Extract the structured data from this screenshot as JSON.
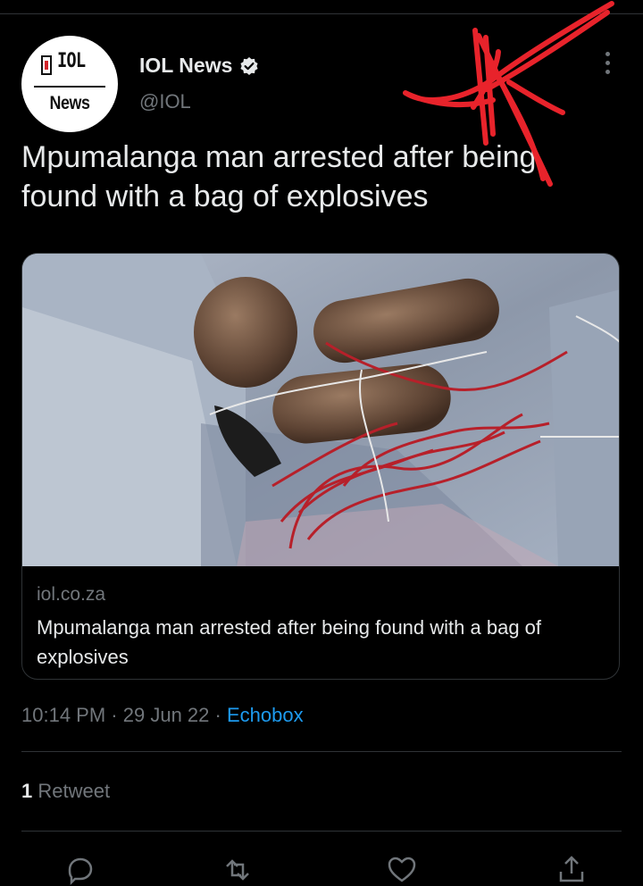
{
  "author": {
    "display_name": "IOL News",
    "handle": "@IOL",
    "verified": true,
    "avatar_logo_top": "IOL",
    "avatar_logo_bottom": "News"
  },
  "tweet": {
    "text": "Mpumalanga man arrested after being found with a bag of explosives",
    "timestamp": "10:14 PM",
    "date": "29 Jun 22",
    "source": "Echobox",
    "separator": "·"
  },
  "card": {
    "domain": "iol.co.za",
    "title": "Mpumalanga man arrested after being found with a bag of explosives"
  },
  "stats": {
    "retweet_count": "1",
    "retweet_label": "Retweet"
  },
  "icons": {
    "more": "more-vertical-icon",
    "verified": "verified-badge-icon",
    "reply": "reply-icon",
    "retweet": "retweet-icon",
    "like": "heart-icon",
    "share": "share-icon"
  },
  "colors": {
    "background": "#000000",
    "text": "#e7e9ea",
    "secondary": "#71767b",
    "link": "#1d9bf0",
    "divider": "#2f3336",
    "annotation": "#e8232b"
  }
}
